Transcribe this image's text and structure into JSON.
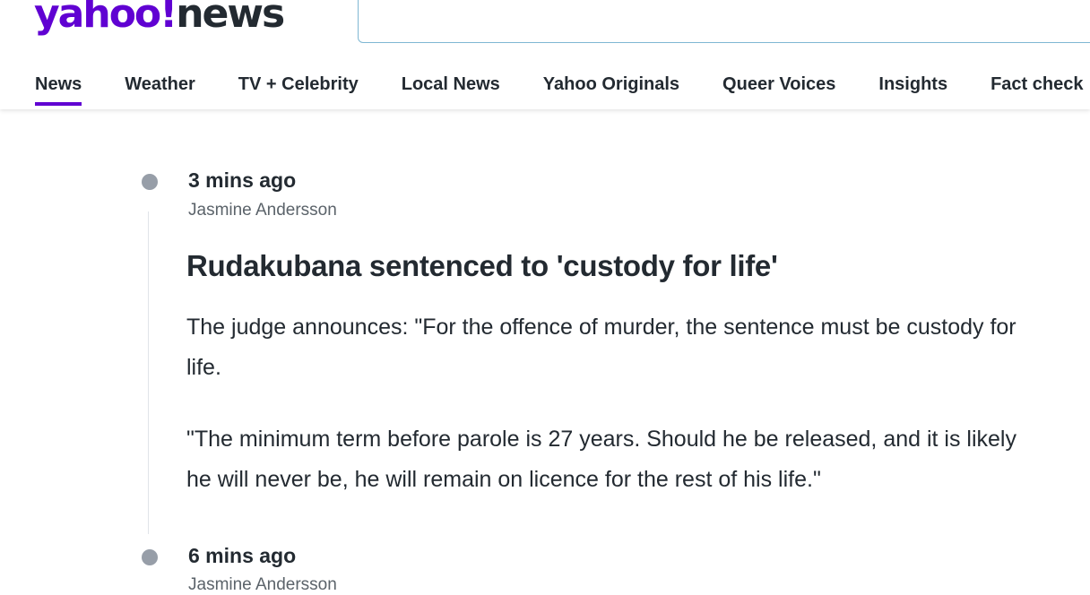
{
  "header": {
    "logo": {
      "brand": "yahoo",
      "bang": "!",
      "section": "news"
    },
    "search": {
      "value": "",
      "placeholder": ""
    }
  },
  "nav": {
    "items": [
      {
        "label": "News",
        "active": true
      },
      {
        "label": "Weather"
      },
      {
        "label": "TV + Celebrity"
      },
      {
        "label": "Local News"
      },
      {
        "label": "Yahoo Originals"
      },
      {
        "label": "Queer Voices"
      },
      {
        "label": "Insights"
      },
      {
        "label": "Fact check"
      }
    ]
  },
  "feed": {
    "entries": [
      {
        "time": "3 mins ago",
        "author": "Jasmine Andersson",
        "headline": "Rudakubana sentenced to 'custody for life'",
        "paragraphs": [
          "The judge announces: \"For the offence of murder, the sentence must be custody for life.",
          "\"The minimum term before parole is 27 years. Should he be released, and it is likely he will never be, he will remain on licence for the rest of his life.\""
        ]
      },
      {
        "time": "6 mins ago",
        "author": "Jasmine Andersson"
      }
    ]
  },
  "colors": {
    "brand": "#6001d2",
    "text": "#232a31",
    "muted": "#5b636a",
    "timeline_dot": "#979ea8"
  }
}
